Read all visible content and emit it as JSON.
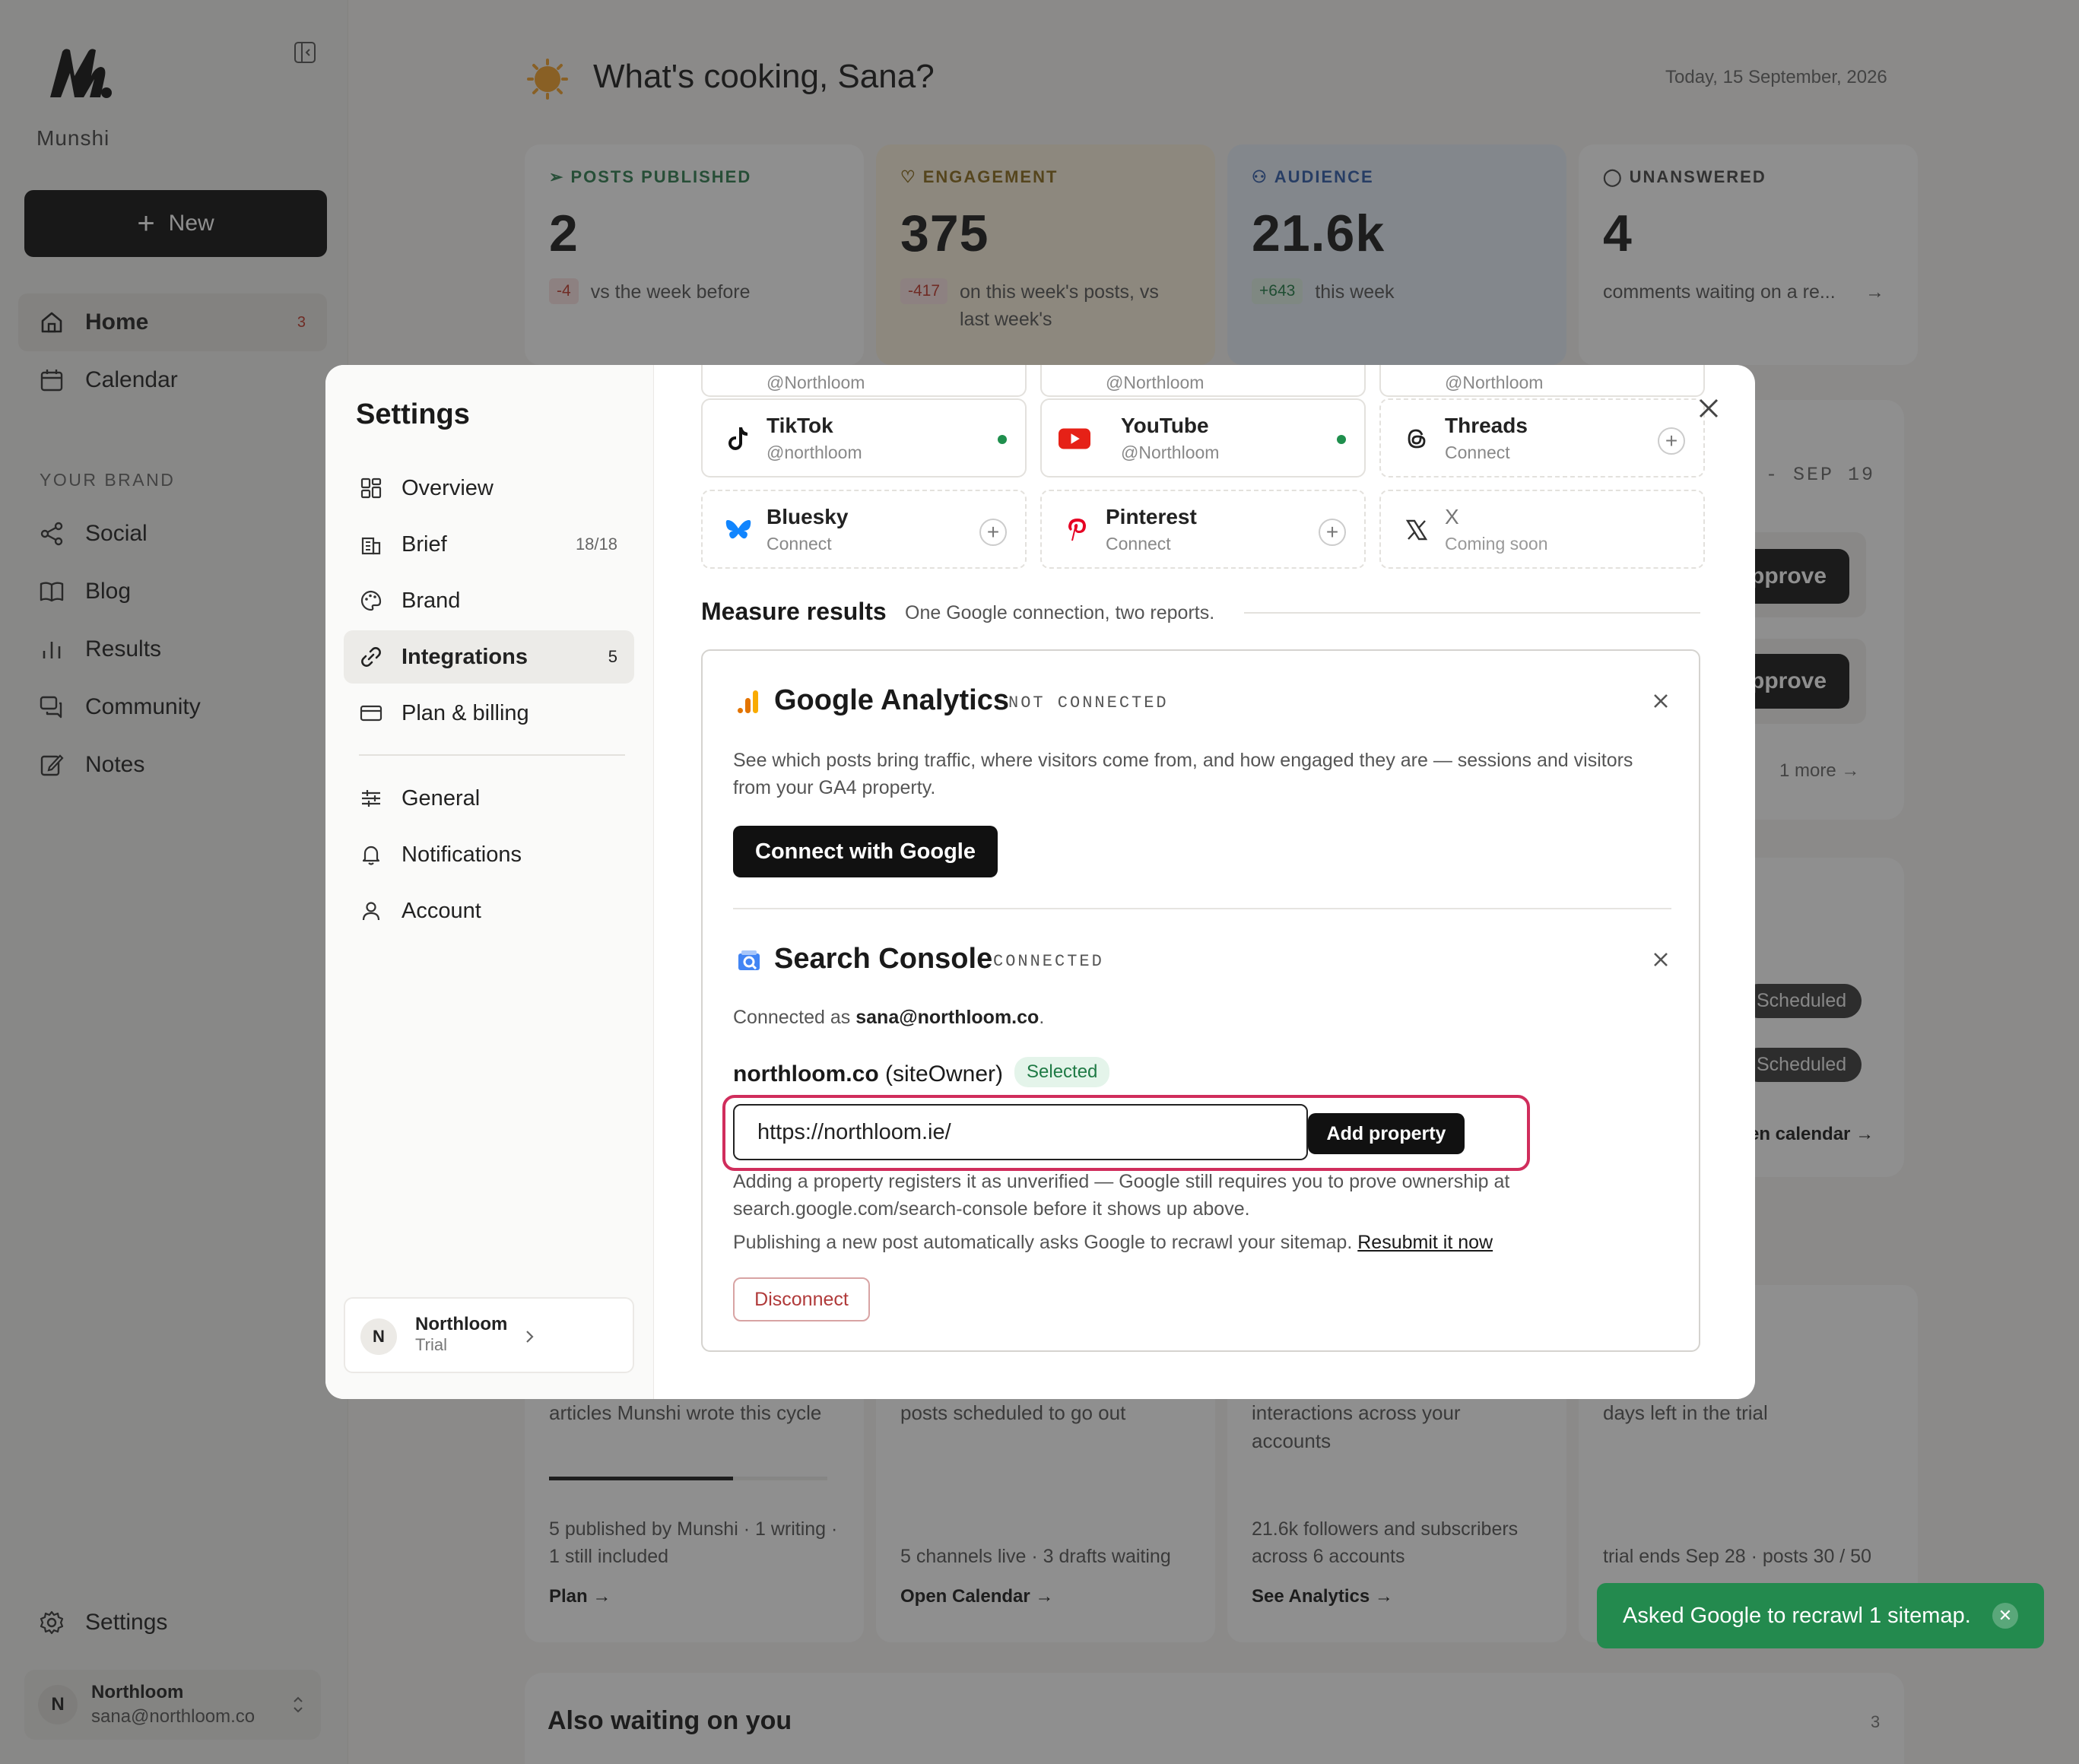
{
  "sidebar": {
    "brand_name": "Munshi",
    "new_label": "New",
    "nav": [
      {
        "label": "Home",
        "count": "3"
      },
      {
        "label": "Calendar"
      }
    ],
    "section_label": "YOUR BRAND",
    "brand_nav": [
      {
        "label": "Social"
      },
      {
        "label": "Blog"
      },
      {
        "label": "Results"
      },
      {
        "label": "Community"
      },
      {
        "label": "Notes"
      }
    ],
    "settings_label": "Settings",
    "user": {
      "initial": "N",
      "name": "Northloom",
      "email": "sana@northloom.co"
    }
  },
  "header": {
    "greeting": "What's cooking, Sana?",
    "date": "Today, 15 September, 2026"
  },
  "stats": [
    {
      "label": "POSTS PUBLISHED",
      "value": "2",
      "delta": "-4",
      "sub": "vs the week before",
      "color": "#2e7d4f",
      "bg": "#ffffff"
    },
    {
      "label": "ENGAGEMENT",
      "value": "375",
      "delta": "-417",
      "sub": "on this week's posts, vs last week's",
      "color": "#8a6a1a",
      "bg": "#fbf0dc"
    },
    {
      "label": "AUDIENCE",
      "value": "21.6k",
      "delta": "+643",
      "sub": "this week",
      "color": "#2f5aa8",
      "bg": "#e7eef8"
    },
    {
      "label": "UNANSWERED",
      "value": "4",
      "sub": "comments waiting on a re...",
      "color": "#444444",
      "bg": "#ffffff"
    }
  ],
  "background": {
    "week_range": "- SEP 19",
    "approve_label": "pprove",
    "more_label": "1 more",
    "scheduled_label": "Scheduled",
    "calendar_link": "en calendar →",
    "cards": [
      {
        "text": "articles Munshi wrote this cycle",
        "detail": "5 published by Munshi · 1 writing · 1 still included",
        "link": "Plan →",
        "progress": 0.66
      },
      {
        "text": "posts scheduled to go out",
        "detail": "5 channels live · 3 drafts waiting",
        "link": "Open Calendar →"
      },
      {
        "text": "interactions across your accounts",
        "detail": "21.6k followers and subscribers across 6 accounts",
        "link": "See Analytics →"
      },
      {
        "text": "days left in the trial",
        "detail": "trial ends Sep 28 · posts 30 / 50"
      }
    ],
    "also_waiting": {
      "title": "Also waiting on you",
      "count": "3"
    }
  },
  "settings": {
    "title": "Settings",
    "nav": [
      {
        "label": "Overview"
      },
      {
        "label": "Brief",
        "count": "18/18"
      },
      {
        "label": "Brand"
      },
      {
        "label": "Integrations",
        "count": "5"
      },
      {
        "label": "Plan & billing"
      },
      {
        "label": "General"
      },
      {
        "label": "Notifications"
      },
      {
        "label": "Account"
      }
    ],
    "workspace": {
      "initial": "N",
      "name": "Northloom",
      "plan": "Trial"
    },
    "channels_cut": [
      "@Northloom",
      "@Northloom",
      "@Northloom"
    ],
    "channels": [
      {
        "name": "TikTok",
        "sub": "@northloom",
        "connected": true
      },
      {
        "name": "YouTube",
        "sub": "@Northloom",
        "connected": true
      },
      {
        "name": "Threads",
        "sub": "Connect",
        "connected": false
      },
      {
        "name": "Bluesky",
        "sub": "Connect",
        "connected": false
      },
      {
        "name": "Pinterest",
        "sub": "Connect",
        "connected": false
      },
      {
        "name": "X",
        "sub": "Coming soon",
        "connected": false
      }
    ],
    "measure": {
      "title": "Measure results",
      "subtitle": "One Google connection, two reports."
    },
    "analytics": {
      "title": "Google Analytics",
      "status": "NOT CONNECTED",
      "description": "See which posts bring traffic, where visitors come from, and how engaged they are — sessions and visitors from your GA4 property.",
      "button": "Connect with Google"
    },
    "search_console": {
      "title": "Search Console",
      "status": "CONNECTED",
      "connected_prefix": "Connected as",
      "connected_email": "sana@northloom.co",
      "connected_suffix": ".",
      "property_name": "northloom.co",
      "property_role": "(siteOwner)",
      "selected_label": "Selected",
      "url_value": "https://northloom.ie/",
      "add_button": "Add property",
      "note": "Adding a property registers it as unverified — Google still requires you to prove ownership at search.google.com/search-console before it shows up above.",
      "publish_note": "Publishing a new post automatically asks Google to recrawl your sitemap.",
      "resubmit_link": "Resubmit it now",
      "disconnect": "Disconnect"
    }
  },
  "toast": {
    "message": "Asked Google to recrawl 1 sitemap."
  }
}
